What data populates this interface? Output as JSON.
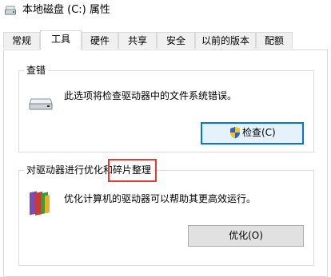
{
  "window": {
    "title": "本地磁盘 (C:) 属性",
    "title_icon": "drive-icon"
  },
  "tabs": [
    {
      "label": "常规",
      "active": false
    },
    {
      "label": "工具",
      "active": true
    },
    {
      "label": "硬件",
      "active": false
    },
    {
      "label": "共享",
      "active": false
    },
    {
      "label": "安全",
      "active": false
    },
    {
      "label": "以前的版本",
      "active": false
    },
    {
      "label": "配额",
      "active": false
    }
  ],
  "error_check": {
    "title": "查错",
    "icon": "hard-drive-icon",
    "description": "此选项将检查驱动器中的文件系统错误。",
    "button_label": "检查(C)",
    "button_icon": "uac-shield-icon"
  },
  "optimize": {
    "title": "对驱动器进行优化和碎片整理",
    "icon": "defrag-icon",
    "description": "优化计算机的驱动器可以帮助其更高效运行。",
    "button_label": "优化(O)"
  },
  "colors": {
    "highlight": "#e53935",
    "focus_border": "#0078d7"
  }
}
